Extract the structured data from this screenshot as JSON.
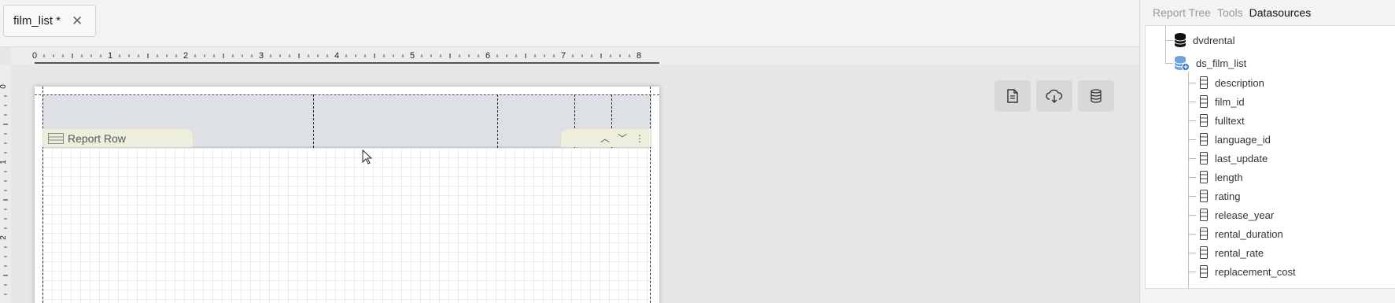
{
  "tab": {
    "title": "film_list *",
    "close": "✕"
  },
  "ruler": {
    "top_labels": [
      "0",
      "1",
      "2",
      "3",
      "4",
      "5",
      "6",
      "7",
      "8"
    ],
    "left_labels": [
      "0",
      "1",
      "2"
    ]
  },
  "band": {
    "row_label": "Report Row",
    "up": "︿",
    "down": "﹀",
    "more": "⋮"
  },
  "fabs": [
    "document-icon",
    "cloud-download-icon",
    "database-icon"
  ],
  "panel": {
    "tabs": [
      "Report Tree",
      "Tools",
      "Datasources"
    ],
    "active_tab": "Datasources",
    "connection": "dvdrental",
    "datasource": "ds_film_list",
    "fields": [
      "description",
      "film_id",
      "fulltext",
      "language_id",
      "last_update",
      "length",
      "rating",
      "release_year",
      "rental_duration",
      "rental_rate",
      "replacement_cost"
    ]
  }
}
